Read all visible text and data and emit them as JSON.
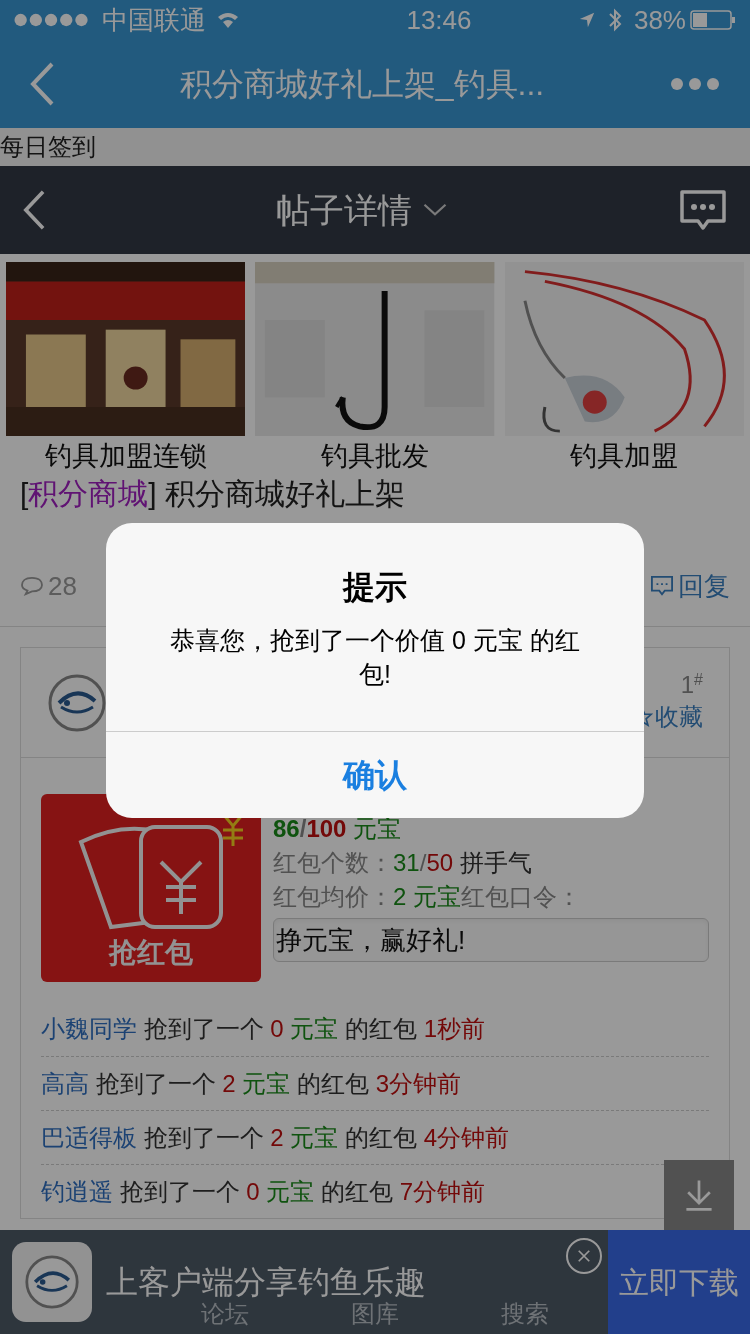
{
  "status_bar": {
    "carrier": "中国联通",
    "time": "13:46",
    "battery": "38%"
  },
  "browser_nav": {
    "title": "积分商城好礼上架_钓具..."
  },
  "sign_in_bar": {
    "label": "每日签到"
  },
  "header": {
    "title": "帖子详情"
  },
  "ads": [
    {
      "label": "钓具加盟连锁",
      "kind": "picture"
    },
    {
      "label": "钓具批发",
      "kind": "picture"
    },
    {
      "label": "钓具加盟",
      "kind": "picture"
    }
  ],
  "post": {
    "tag_open": "[",
    "tag": "积分商城",
    "tag_close": "]",
    "title": "积分商城好礼上架",
    "comments": "28",
    "reply": "回复"
  },
  "floor": {
    "number": "1",
    "mark": "#",
    "favorite": "收藏"
  },
  "red_packet": {
    "button_label": "抢红包",
    "claimed": "86",
    "claimed_sep": "/",
    "total": "100",
    "unit": "元宝",
    "count_label": "红包个数：",
    "count_claimed": "31",
    "count_sep": "/",
    "count_total": "50",
    "count_note": "拼手气",
    "avg_label": "红包均价：",
    "avg_value": "2 元宝",
    "password_label": "红包口令：",
    "password": "挣元宝，赢好礼!"
  },
  "grabs": [
    {
      "user": "小魏同学",
      "action": "抢到了一个",
      "amount": "0",
      "unit": "元宝",
      "suffix": "的红包",
      "time": "1秒前"
    },
    {
      "user": "高高",
      "action": "抢到了一个",
      "amount": "2",
      "unit": "元宝",
      "suffix": "的红包",
      "time": "3分钟前"
    },
    {
      "user": "巴适得板",
      "action": "抢到了一个",
      "amount": "2",
      "unit": "元宝",
      "suffix": "的红包",
      "time": "4分钟前"
    },
    {
      "user": "钓逍遥",
      "action": "抢到了一个",
      "amount": "0",
      "unit": "元宝",
      "suffix": "的红包",
      "time": "7分钟前"
    }
  ],
  "tab_bar": [
    {
      "label": "论坛"
    },
    {
      "label": "图库"
    },
    {
      "label": "搜索"
    }
  ],
  "app_banner": {
    "text": "上客户端分享钓鱼乐趣",
    "download": "立即下载"
  },
  "dialog": {
    "title": "提示",
    "message": "恭喜您，抢到了一个价值 0 元宝 的红包!",
    "confirm": "确认"
  }
}
